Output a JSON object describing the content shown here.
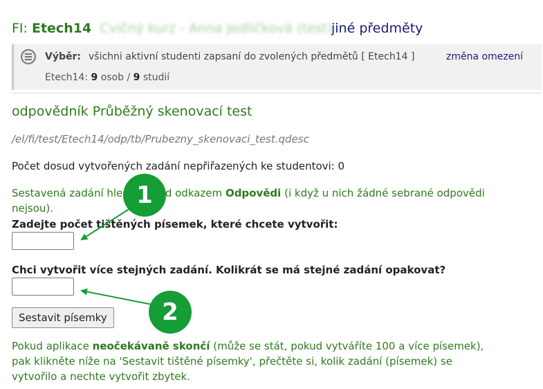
{
  "header": {
    "prefix": "FI:",
    "course_code": "Etech14",
    "course_name_blurred": "Cvičný kurz - Anna Jedličková (test)",
    "other_subjects_link": "jiné předměty"
  },
  "filter": {
    "icon": "filter-list-icon",
    "label": "Výběr:",
    "text": "všichni aktivní studenti zapsaní do zvolených předmětů [ Etech14 ]",
    "change_link": "změna omezení",
    "count_prefix": "Etech14:",
    "persons": "9",
    "persons_unit": "osob /",
    "studies": "9",
    "studies_unit": "studií"
  },
  "main": {
    "title": "odpovědník Průběžný skenovací test",
    "path": "/el/fi/test/Etech14/odp/tb/Prubezny_skenovaci_test.qdesc",
    "count_line": "Počet dosud vytvořených zadání nepřiřazených ke studentovi: 0",
    "note_before": "Sestavená zadání hledejte pod odkazem",
    "note_link": "Odpovědi",
    "note_after": "(i když u nich žádné sebrané odpovědi nejsou).",
    "field1_label": "Zadejte počet tištěných písemek, které chcete vytvořit:",
    "field1_value": "",
    "field2_label": "Chci vytvořit více stejných zadání. Kolikrát se má stejné zadání opakovat?",
    "field2_value": "",
    "submit_label": "Sestavit písemky",
    "warn_before": "Pokud aplikace",
    "warn_bold": "neočekávaně skončí",
    "warn_after": "(může se stát, pokud vytváříte 100 a více písemek), pak klikněte níže na 'Sestavit tištěné písemky', přečtěte si, kolik zadání (písemek) se vytvořilo a nechte vytvořit zbytek."
  },
  "callouts": {
    "one": "1",
    "two": "2",
    "color": "#159d36"
  }
}
